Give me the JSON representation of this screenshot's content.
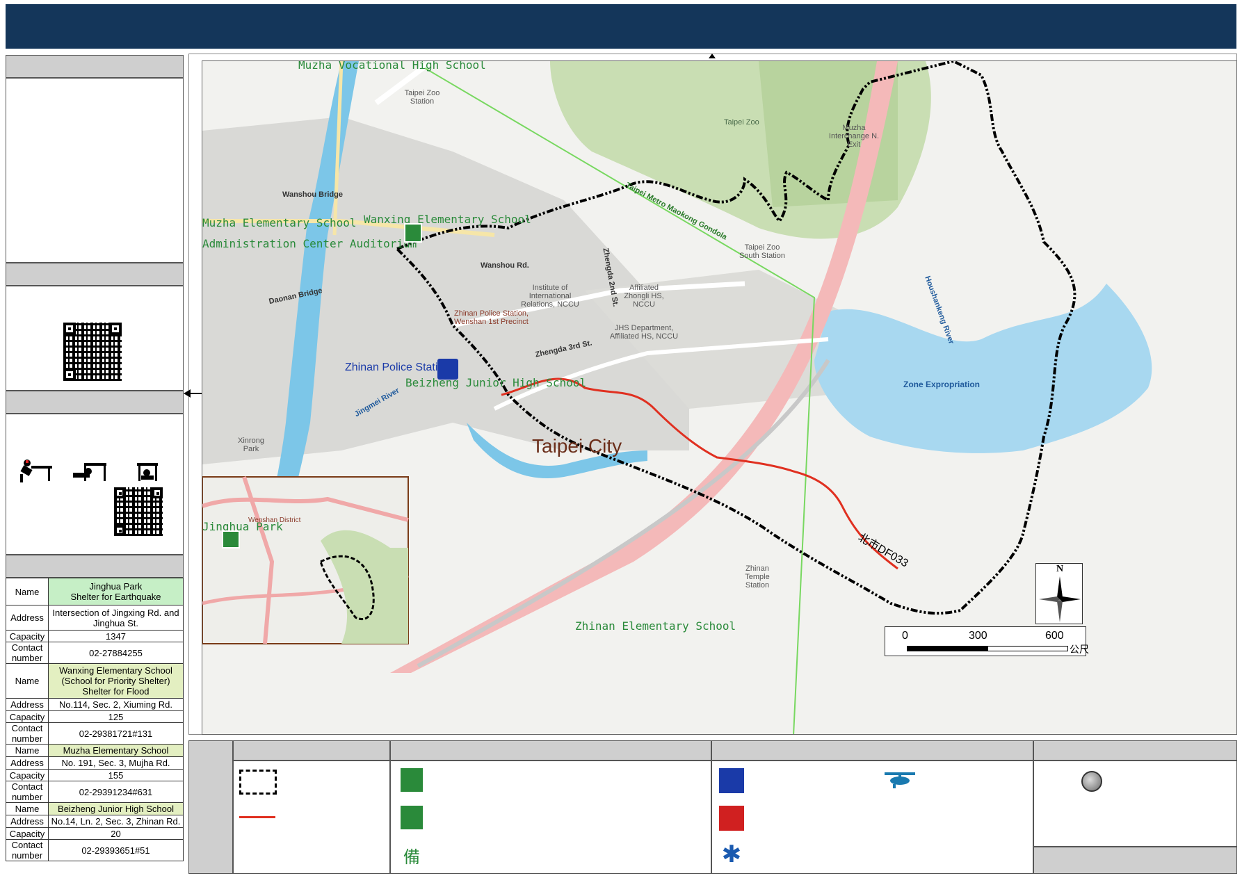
{
  "map": {
    "labels": {
      "muzha_vocational": "Muzha Vocational High School",
      "muzha_elementary": "Muzha Elementary School",
      "admin_center": "Administration Center Auditorium",
      "wanxing_elementary": "Wanxing Elementary School",
      "zhinan_police": "Zhinan Police Station",
      "beizheng_junior": "Beizheng Junior High School",
      "taipei_city": "Taipei City",
      "zhinan_elementary": "Zhinan Elementary School",
      "jinghua_park": "Jinghua Park",
      "taipei_zoo": "Taipei Zoo",
      "zoo_station": "Taipei Zoo Station",
      "zoo_south": "Taipei Zoo South Station",
      "gondola": "Taipei Metro Maokong Gondola",
      "wanshou_bridge": "Wanshou Bridge",
      "wanshou_rd": "Wanshou Rd.",
      "daonan_bridge": "Daonan Bridge",
      "jingmei_river": "Jingmei River",
      "houshankeng": "Houshankeng River",
      "zone_expropriation": "Zone Expropriation",
      "debris_flow_id": "北市DF033",
      "zhengda_3rd": "Zhengda 3rd St.",
      "zhengda_2nd": "Zhengda 2nd St.",
      "institute": "Institute of International Relations, NCCU",
      "affiliated_zhongli": "Affiliated Zhongli HS, NCCU",
      "jhs_department": "JHS Department, Affiliated HS, NCCU",
      "zhinan_temple": "Zhinan Temple Station",
      "muzha_interchange": "Muzha Interchange N. Exit",
      "xinrong_park": "Xinrong Park",
      "zhinan_precinct": "Zhinan Police Station, Wenshan 1st Precinct",
      "wenshan_district": "Wenshan District"
    },
    "scale": {
      "ticks": [
        "0",
        "300",
        "600"
      ],
      "unit": "公尺"
    },
    "north": "N"
  },
  "shelters": [
    {
      "name_key": "Name",
      "name": "Jinghua Park\nShelter for Earthquake",
      "address_key": "Address",
      "address": "Intersection of Jingxing Rd. and Jinghua St.",
      "capacity_key": "Capacity",
      "capacity": "1347",
      "contact_key": "Contact number",
      "contact": "02-27884255",
      "style": "green"
    },
    {
      "name_key": "Name",
      "name": "Wanxing Elementary School (School for Priority Shelter) Shelter for Flood",
      "address_key": "Address",
      "address": "No.114, Sec. 2, Xiuming Rd.",
      "capacity_key": "Capacity",
      "capacity": "125",
      "contact_key": "Contact number",
      "contact": "02-29381721#131",
      "style": "olive"
    },
    {
      "name_key": "Name",
      "name": "Muzha Elementary School",
      "address_key": "Address",
      "address": "No. 191, Sec. 3, Mujha Rd.",
      "capacity_key": "Capacity",
      "capacity": "155",
      "contact_key": "Contact number",
      "contact": "02-29391234#631",
      "style": "olive"
    },
    {
      "name_key": "Name",
      "name": "Beizheng Junior High School",
      "address_key": "Address",
      "address": "No.14, Ln. 2, Sec. 3, Zhinan Rd.",
      "capacity_key": "Capacity",
      "capacity": "20",
      "contact_key": "Contact number",
      "contact": "02-29393651#51",
      "style": "olive"
    }
  ],
  "colors": {
    "header": "#14365a",
    "boundary": "#000000",
    "debris_flow": "#e03020",
    "water": "#a8d8f0",
    "park": "#c8e0b0",
    "school_green": "#2a8a3a",
    "police_blue": "#1a3aa8"
  }
}
